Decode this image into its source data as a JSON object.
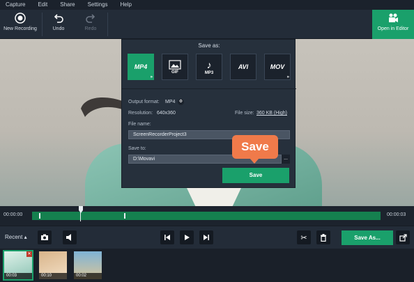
{
  "menu": [
    "Capture",
    "Edit",
    "Share",
    "Settings",
    "Help"
  ],
  "toolbar": {
    "new_recording": "New Recording",
    "undo": "Undo",
    "redo": "Redo",
    "open_in_editor": "Open in Editor"
  },
  "dialog": {
    "title": "Save as:",
    "formats": [
      {
        "label": "MP4",
        "selected": true
      },
      {
        "label": "GIF",
        "selected": false
      },
      {
        "label": "MP3",
        "selected": false
      },
      {
        "label": "AVI",
        "selected": false
      },
      {
        "label": "MOV",
        "selected": false
      }
    ],
    "output_format_label": "Output format:",
    "output_format_value": "MP4",
    "resolution_label": "Resolution:",
    "resolution_value": "640x360",
    "file_size_label": "File size:",
    "file_size_value": "360 KB (High)",
    "file_name_label": "File name:",
    "file_name_value": "ScreenRecorderProject3",
    "save_to_label": "Save to:",
    "save_to_value": "D:\\Movavi",
    "browse": "...",
    "save_button": "Save"
  },
  "callout": {
    "text": "Save"
  },
  "timeline": {
    "start_time": "00:00:00",
    "end_time": "00:00:03"
  },
  "controls": {
    "recent": "Recent ▴",
    "save_as": "Save As..."
  },
  "thumbnails": [
    {
      "duration": "00:03",
      "selected": true
    },
    {
      "duration": "00:10",
      "selected": false
    },
    {
      "duration": "00:02",
      "selected": false
    }
  ],
  "colors": {
    "accent": "#1aa06b",
    "callout": "#f07a4a",
    "panel": "#232c38"
  }
}
